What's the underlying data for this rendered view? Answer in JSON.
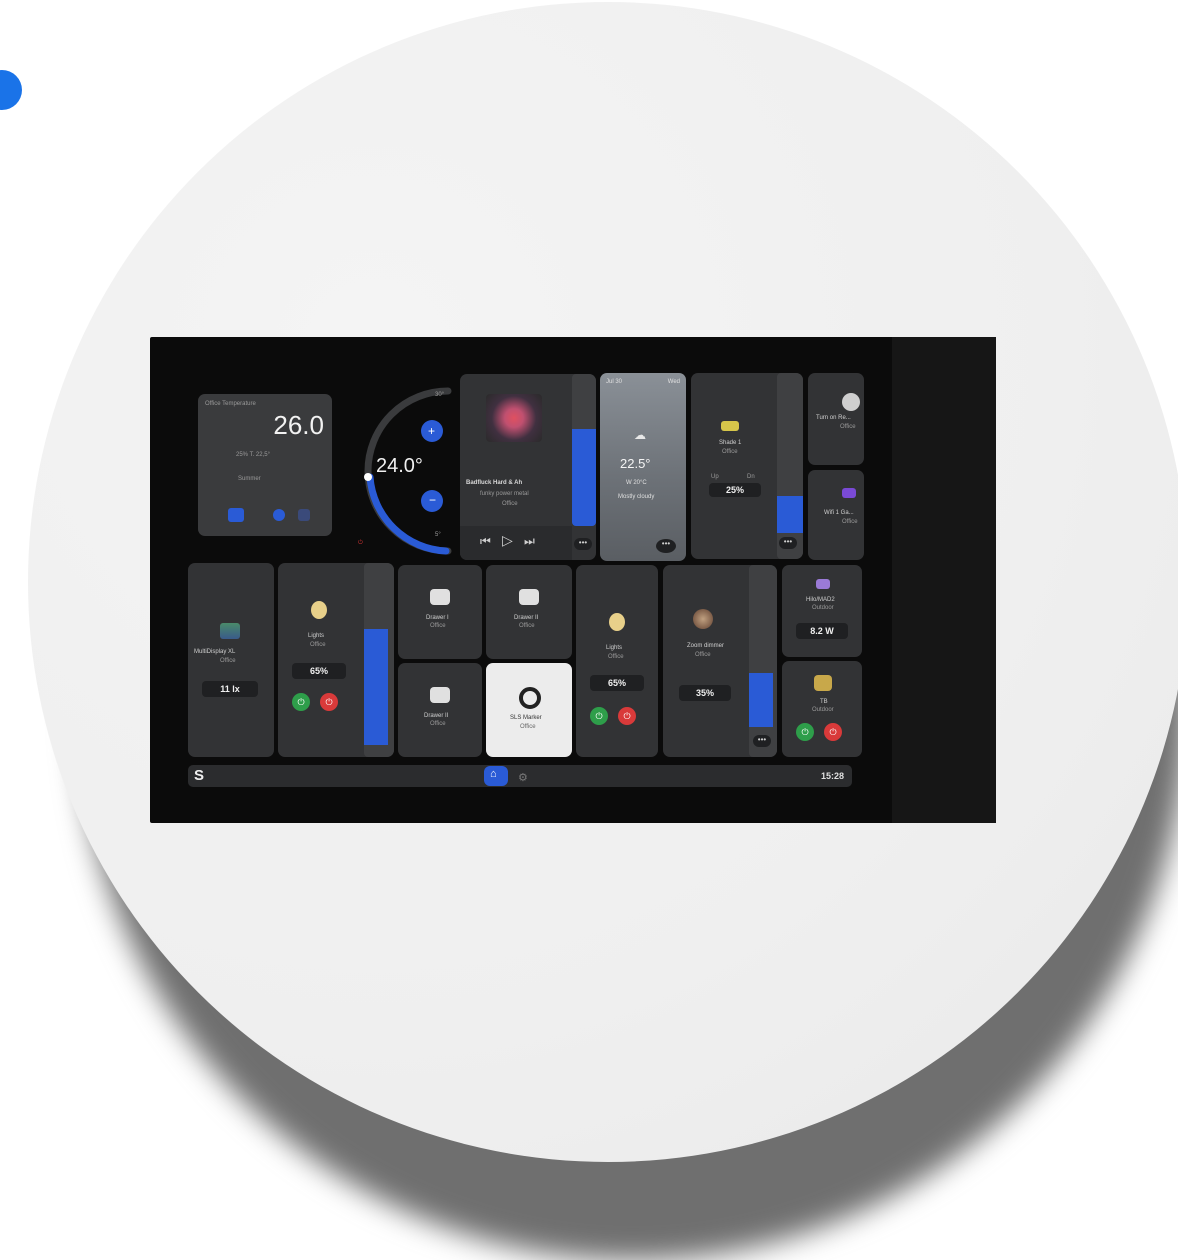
{
  "colors": {
    "accent": "#2a5bd6",
    "dot": "#1a73e8",
    "card": "#323335",
    "screen": "#1e1f21"
  },
  "climate_card": {
    "title": "Office Temperature",
    "temperature": "26.0",
    "status": "25% T. 22,5°",
    "mode": "Summer"
  },
  "thermostat": {
    "setpoint": "24.0°",
    "max_label": "30°",
    "min_label": "5°"
  },
  "media": {
    "title": "Badfluck Hard & Ah",
    "artist": "funky power metal",
    "room": "Office",
    "volume_level": 0.65,
    "controls": {
      "rewind": "⏮",
      "play": "▷",
      "forward": "⏭"
    },
    "more": "•••"
  },
  "weather": {
    "left": "Jul 30",
    "right": "Wed",
    "temperature": "22.5°",
    "line1": "W 20°C",
    "line2": "Mostly cloudy",
    "more": "•••"
  },
  "shade1": {
    "name": "Shade 1",
    "room": "Office",
    "left_label": "Up",
    "right_label": "Dn",
    "value": "25%",
    "level": 0.3,
    "more": "•••"
  },
  "mini_tiles": [
    {
      "name": "Turn on Re...",
      "sub": "Office"
    },
    {
      "name": "Wifi 1 Ga...",
      "sub": "Office"
    }
  ],
  "multidisplay": {
    "name": "MultiDisplay XL",
    "room": "Office",
    "value": "11 lx"
  },
  "lights1": {
    "name": "Lights",
    "room": "Office",
    "value": "65%",
    "level": 0.8,
    "on": "⏻",
    "off": "⏻"
  },
  "drawers": [
    {
      "name": "Drawer I",
      "room": "Office"
    },
    {
      "name": "Drawer II",
      "room": "Office"
    },
    {
      "name": "Drawer II",
      "room": "Office"
    }
  ],
  "sls": {
    "name": "SLS Marker",
    "room": "Office"
  },
  "lights2": {
    "name": "Lights",
    "room": "Office",
    "value": "65%",
    "on": "⏻",
    "off": "⏻"
  },
  "dimmer": {
    "name": "Zoom dimmer",
    "room": "Office",
    "value": "35%",
    "level": 0.35,
    "more": "•••"
  },
  "power": {
    "name": "Hilo/MAD2",
    "room": "Outdoor",
    "value": "8.2 W"
  },
  "fan": {
    "name": "TB",
    "room": "Outdoor",
    "on": "⏻",
    "off": "⏻"
  },
  "toolbar": {
    "logo": "S",
    "time": "15:28"
  }
}
